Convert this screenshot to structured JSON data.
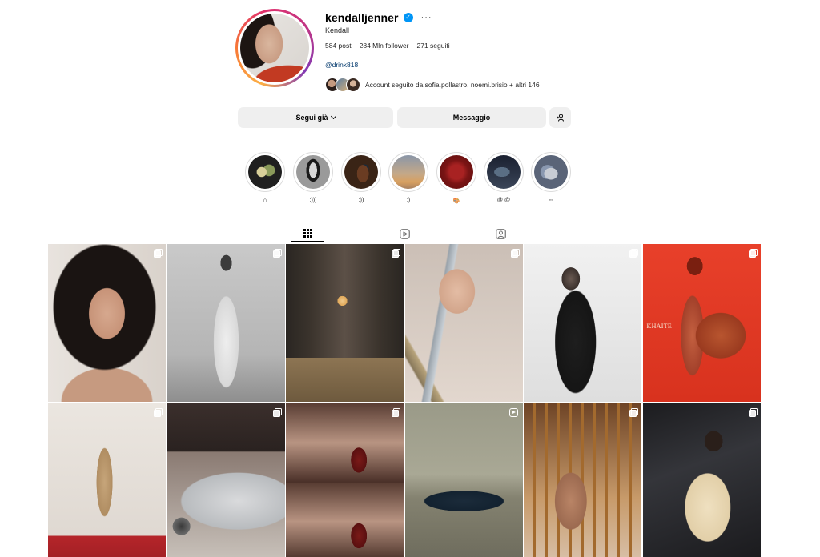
{
  "profile": {
    "username": "kendalljenner",
    "full_name": "Kendall",
    "stats": {
      "posts": "584 post",
      "followers": "284 Mln follower",
      "following": "271 seguiti"
    },
    "link": "@drink818",
    "followed_by": "Account seguito da sofia.pollastro, noemi.brisio + altri 146",
    "more_icon": "more-horizontal-icon",
    "verified_icon": "verified-badge-icon"
  },
  "actions": {
    "follow_label": "Segui già",
    "message_label": "Messaggio",
    "suggest_icon": "add-person-icon"
  },
  "highlights": [
    {
      "label": "∩"
    },
    {
      "label": ":)))"
    },
    {
      "label": ":))"
    },
    {
      "label": ":)"
    },
    {
      "label": "🎨"
    },
    {
      "label": "@ @"
    },
    {
      "label": "◦◦"
    }
  ],
  "tabs": [
    {
      "name": "posts",
      "icon": "grid-icon",
      "active": true
    },
    {
      "name": "reels",
      "icon": "reels-icon",
      "active": false
    },
    {
      "name": "tagged",
      "icon": "tagged-icon",
      "active": false
    }
  ],
  "posts": [
    {
      "type": "carousel",
      "text": ""
    },
    {
      "type": "carousel",
      "text": ""
    },
    {
      "type": "carousel",
      "text": ""
    },
    {
      "type": "carousel",
      "text": ""
    },
    {
      "type": "carousel",
      "text": ""
    },
    {
      "type": "carousel",
      "text": "KHAITE"
    },
    {
      "type": "carousel",
      "text": ""
    },
    {
      "type": "carousel",
      "text": ""
    },
    {
      "type": "carousel",
      "text": ""
    },
    {
      "type": "reel",
      "text": ""
    },
    {
      "type": "carousel",
      "text": ""
    },
    {
      "type": "carousel",
      "text": ""
    }
  ],
  "colors": {
    "link": "#00376b",
    "verified": "#0095f6",
    "button_bg": "#efefef",
    "border": "#dbdbdb"
  }
}
